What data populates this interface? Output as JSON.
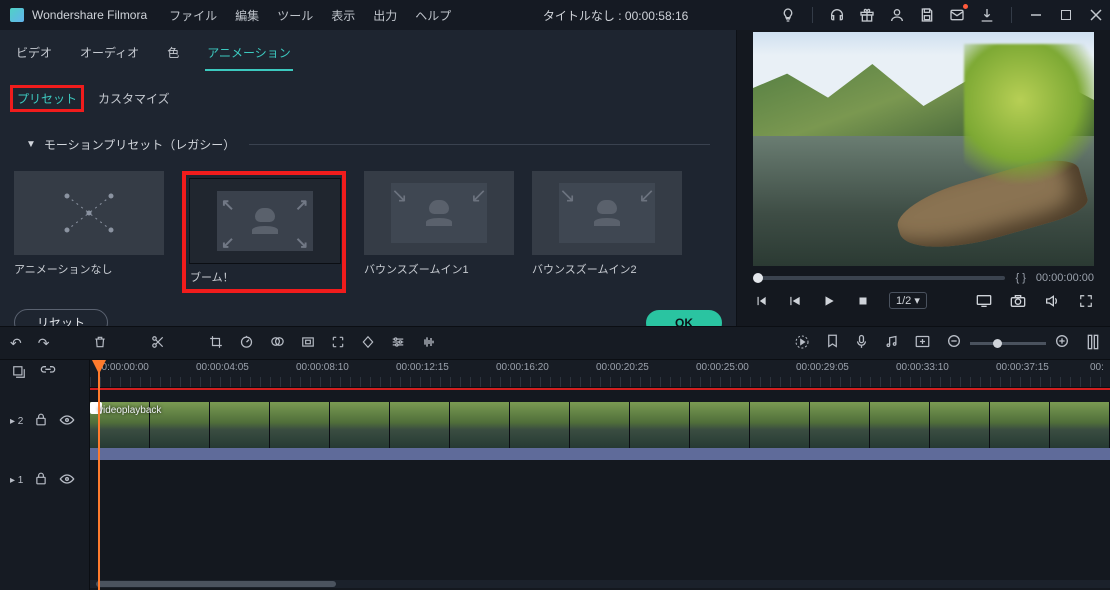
{
  "titlebar": {
    "app_name": "Wondershare Filmora",
    "menu": [
      "ファイル",
      "編集",
      "ツール",
      "表示",
      "出力",
      "ヘルプ"
    ],
    "project_label": "タイトルなし : 00:00:58:16"
  },
  "panel": {
    "tabs": {
      "video": "ビデオ",
      "audio": "オーディオ",
      "color": "色",
      "animation": "アニメーション"
    },
    "subtabs": {
      "preset": "プリセット",
      "customize": "カスタマイズ"
    },
    "section_title": "モーションプリセット（レガシー）",
    "presets": [
      {
        "id": "none",
        "label": "アニメーションなし"
      },
      {
        "id": "boom",
        "label": "ブーム！"
      },
      {
        "id": "bzi1",
        "label": "バウンスズームイン1"
      },
      {
        "id": "bzi2",
        "label": "バウンスズームイン2"
      }
    ],
    "reset_label": "リセット",
    "ok_label": "OK"
  },
  "preview": {
    "braces": "{       }",
    "timecode": "00:00:00:00",
    "ratio": "1/2 ▾"
  },
  "toolbar_icons": {
    "undo": "undo",
    "redo": "redo",
    "delete": "delete",
    "cut": "cut",
    "crop": "crop",
    "speed": "speed",
    "colormatch": "colormatch",
    "keyframe": "keyframe",
    "markers": "markers",
    "motion": "motion",
    "adjust": "adjust",
    "audio": "audio"
  },
  "timeline": {
    "track_ctrl": {
      "select_all": "select-all",
      "link": "link"
    },
    "tracks": [
      {
        "id": 2,
        "label": "▸ 2"
      },
      {
        "id": 1,
        "label": "▸ 1"
      }
    ],
    "clip_name": "videoplayback",
    "ruler": [
      "00:00:00:00",
      "00:00:04:05",
      "00:00:08:10",
      "00:00:12:15",
      "00:00:16:20",
      "00:00:20:25",
      "00:00:25:00",
      "00:00:29:05",
      "00:00:33:10",
      "00:00:37:15",
      "00:"
    ]
  }
}
